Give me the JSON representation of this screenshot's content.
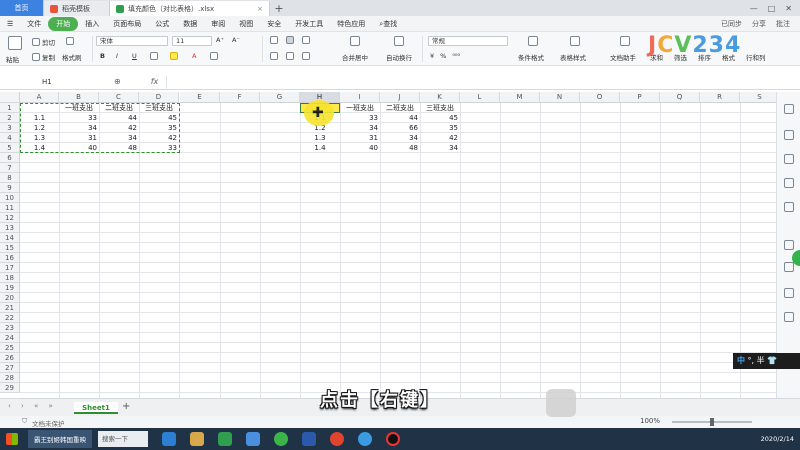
{
  "tabs": [
    {
      "label": "首页",
      "icon": "home-icon"
    },
    {
      "label": "稻壳模板",
      "icon": "docer-icon"
    },
    {
      "label": "填充颜色（对比表格）.xlsx",
      "icon": "excel-file-icon"
    }
  ],
  "menu": [
    "文件",
    "开始",
    "插入",
    "页面布局",
    "公式",
    "数据",
    "审阅",
    "视图",
    "安全",
    "开发工具",
    "特色应用"
  ],
  "menu_search": "查找",
  "menu_right": [
    "已同步",
    "分享",
    "批注"
  ],
  "ribbon": {
    "cut": "剪切",
    "paste": "粘贴",
    "copy": "复制",
    "format_painter": "格式刷",
    "font_name": "宋体",
    "font_size": "11",
    "bold": "B",
    "italic": "I",
    "underline": "U",
    "merge": "合并居中",
    "wrap": "自动换行",
    "number_format": "常规",
    "conditional": "条件格式",
    "table_style": "表格样式",
    "doc_helper": "文档助手",
    "sum": "求和",
    "filter": "筛选",
    "sort": "排序",
    "format": "格式",
    "rows_cols": "行和列"
  },
  "watermark": [
    "J",
    "C",
    "V",
    "234"
  ],
  "formula": {
    "namebox": "H1",
    "fx": "fx",
    "value": ""
  },
  "columns": [
    "A",
    "B",
    "C",
    "D",
    "E",
    "F",
    "G",
    "H",
    "I",
    "J",
    "K",
    "L",
    "M",
    "N",
    "O",
    "P",
    "Q",
    "R",
    "S"
  ],
  "rows": [
    "1",
    "2",
    "3",
    "4",
    "5",
    "6",
    "7",
    "8",
    "9",
    "10",
    "11",
    "12",
    "13",
    "14",
    "15",
    "16",
    "17",
    "18",
    "19",
    "20",
    "21",
    "22",
    "23",
    "24",
    "25",
    "26",
    "27",
    "28",
    "29"
  ],
  "table_left": {
    "headers": [
      "一班支出",
      "二班支出",
      "三班支出"
    ],
    "rows": [
      {
        "label": "1.1",
        "values": [
          "33",
          "44",
          "45"
        ]
      },
      {
        "label": "1.2",
        "values": [
          "34",
          "42",
          "35"
        ]
      },
      {
        "label": "1.3",
        "values": [
          "31",
          "34",
          "42"
        ]
      },
      {
        "label": "1.4",
        "values": [
          "40",
          "48",
          "33"
        ]
      }
    ]
  },
  "table_right": {
    "headers": [
      "一班支出",
      "二班支出",
      "三班支出"
    ],
    "rows": [
      {
        "label": "1.1",
        "values": [
          "33",
          "44",
          "45"
        ]
      },
      {
        "label": "1.2",
        "values": [
          "34",
          "66",
          "35"
        ]
      },
      {
        "label": "1.3",
        "values": [
          "31",
          "34",
          "42"
        ]
      },
      {
        "label": "1.4",
        "values": [
          "40",
          "48",
          "34"
        ]
      }
    ]
  },
  "sheet_tab": "Sheet1",
  "status": {
    "protect": "文档未保护",
    "zoom": "100%"
  },
  "subtitle": "点击【右键】",
  "ime": {
    "mode": "中",
    "half": "半"
  },
  "taskbar": {
    "app": "霸王别姬韩国重映",
    "search": "搜索一下",
    "time": "",
    "date": "2020/2/14"
  },
  "colors": {
    "accent_green": "#4caf50",
    "highlight_yellow": "#ffe94d",
    "tab_blue": "#3d82e0"
  }
}
